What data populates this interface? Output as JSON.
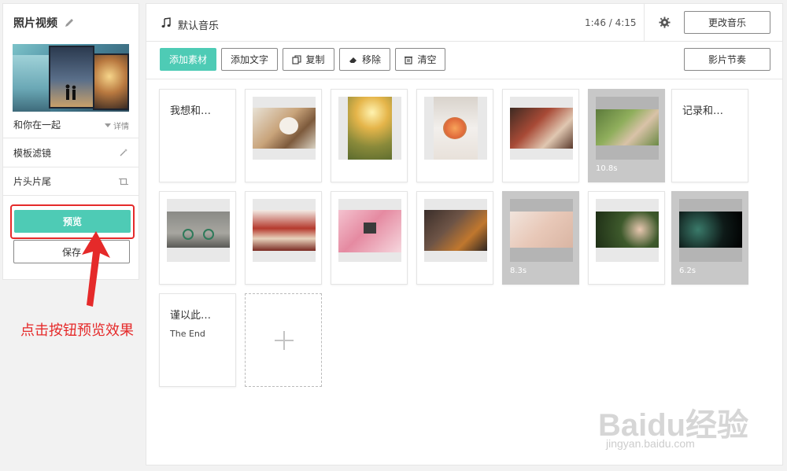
{
  "sidebar": {
    "title": "照片视频",
    "cover_caption": "和你在一起",
    "detail_label": "详情",
    "rows": [
      {
        "label": "模板滤镜"
      },
      {
        "label": "片头片尾"
      }
    ],
    "preview_label": "预览",
    "save_label": "保存"
  },
  "annotation": {
    "text": "点击按钮预览效果",
    "color": "#e52a2a"
  },
  "topbar": {
    "music_label": "默认音乐",
    "time": "1:46 / 4:15",
    "change_music_label": "更改音乐"
  },
  "toolbar": {
    "add_material": "添加素材",
    "add_text": "添加文字",
    "copy": "复制",
    "remove": "移除",
    "clear": "清空",
    "rhythm": "影片节奏"
  },
  "clips": [
    {
      "type": "text",
      "text": "我想和…"
    },
    {
      "type": "photo",
      "subject": "dog"
    },
    {
      "type": "photo",
      "subject": "girl-sunlight"
    },
    {
      "type": "photo",
      "subject": "bride-bouquet"
    },
    {
      "type": "photo",
      "subject": "cake-hands"
    },
    {
      "type": "video",
      "subject": "hand-grass",
      "duration": "10.8s"
    },
    {
      "type": "text",
      "text": "记录和…"
    },
    {
      "type": "photo",
      "subject": "bicycle"
    },
    {
      "type": "photo",
      "subject": "desserts"
    },
    {
      "type": "photo",
      "subject": "camera-girl"
    },
    {
      "type": "photo",
      "subject": "guitar"
    },
    {
      "type": "video",
      "subject": "baby-feet",
      "duration": "8.3s"
    },
    {
      "type": "photo",
      "subject": "dandelion-girl"
    },
    {
      "type": "video",
      "subject": "bokeh-night",
      "duration": "6.2s"
    },
    {
      "type": "text",
      "text": "谨以此…",
      "sub": "The End"
    }
  ],
  "watermark": {
    "brand": "Baidu经验",
    "url": "jingyan.baidu.com"
  },
  "colors": {
    "accent": "#4ecbb5",
    "annotation_red": "#e52a2a"
  }
}
